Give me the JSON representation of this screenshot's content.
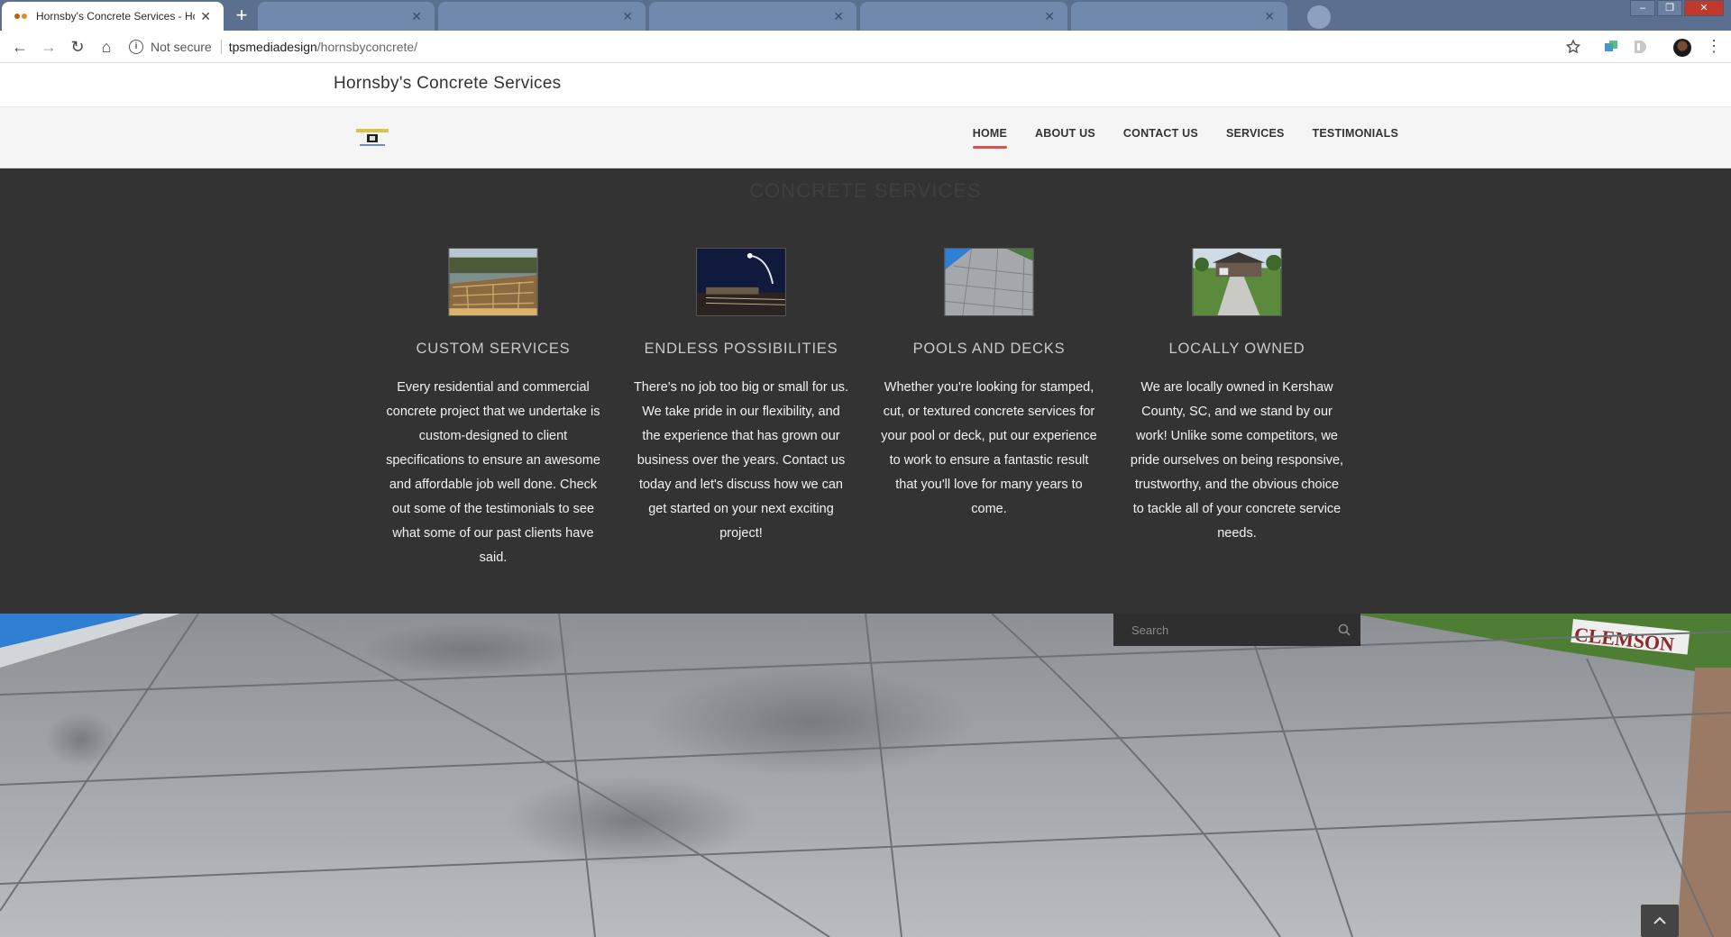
{
  "browser": {
    "active_tab_title": "Hornsby's Concrete Services - Ho",
    "security_label": "Not secure",
    "url_domain": "tpsmediadesign",
    "url_path": "/hornsbyconcrete/"
  },
  "site": {
    "title": "Hornsby's Concrete Services",
    "nav": {
      "home": "HOME",
      "about": "ABOUT US",
      "contact": "CONTACT US",
      "services": "SERVICES",
      "testimonials": "TESTIMONIALS"
    },
    "section_heading": "CONCRETE SERVICES",
    "cards": [
      {
        "title": "CUSTOM SERVICES",
        "text": "Every residential and commercial concrete project that we undertake is custom-designed to client specifications to ensure an awesome and affordable job well done. Check out some of the testimonials to see what some of our past clients have said."
      },
      {
        "title": "ENDLESS POSSIBILITIES",
        "text": "There's no job too big or small for us. We take pride in our flexibility, and the experience that has grown our business over the years. Contact us today and let's discuss how we can get started on your next exciting project!"
      },
      {
        "title": "POOLS AND DECKS",
        "text": "Whether you're looking for stamped, cut, or textured concrete services for your pool or deck, put our experience to work to ensure a fantastic result that you'll love for many years to come."
      },
      {
        "title": "LOCALLY OWNED",
        "text": "We are locally owned in Kershaw County, SC, and we stand by our work! Unlike some competitors, we pride ourselves on being responsive, trustworthy, and the obvious choice to tackle all of your concrete service needs."
      }
    ],
    "search": {
      "placeholder": "Search"
    },
    "hero_sign_text": "CLEMSON"
  }
}
